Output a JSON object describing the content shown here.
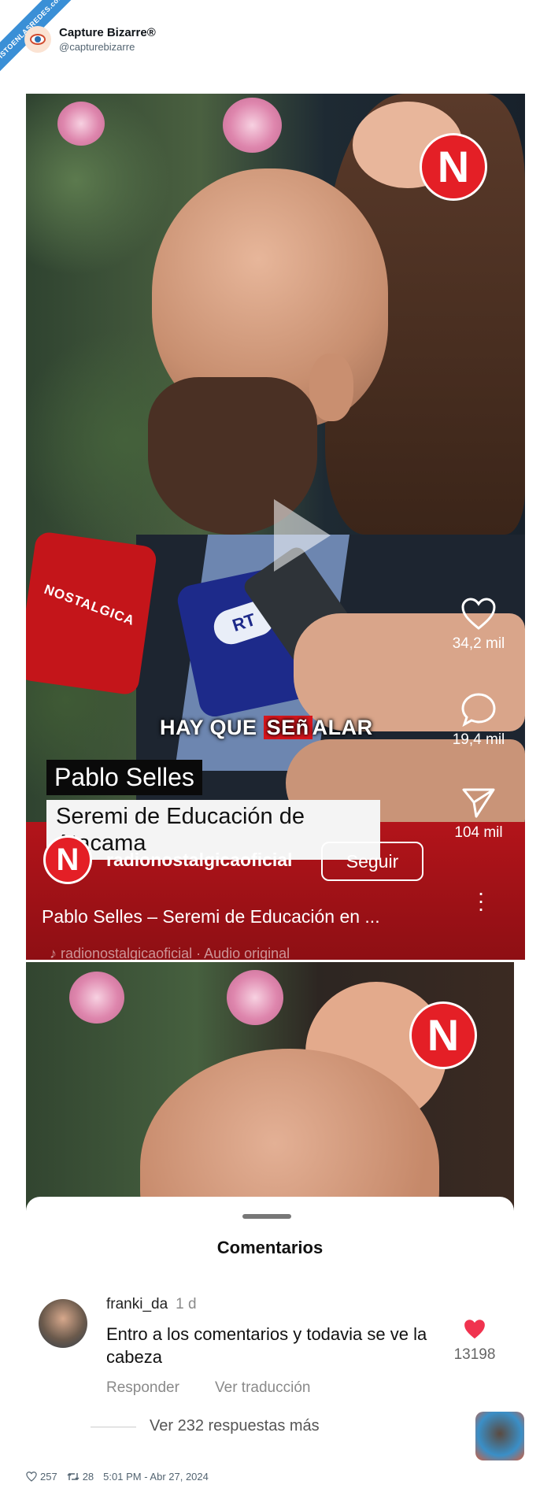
{
  "watermark": {
    "text": "VISTOENLASREDES.com"
  },
  "account": {
    "name": "Capture Bizarre®",
    "handle": "@capturebizarre"
  },
  "video1": {
    "brand_logo_letter": "N",
    "caption_pre": "HAY QUE ",
    "caption_highlight": "SEñ",
    "caption_post": "ALAR",
    "mic_red_text": "NOSTALGICA",
    "mic_blue_text": "RT",
    "lower_third_name": "Pablo Selles",
    "lower_third_role": "Seremi de Educación de Atacama",
    "stats": {
      "likes": "34,2 mil",
      "comments": "19,4 mil",
      "shares": "104 mil"
    },
    "channel_name": "radionostalgicaoficial",
    "follow_label": "Seguir",
    "description": "Pablo Selles – Seremi de Educación en ...",
    "audio": "♪ radionostalgicaoficial · Audio original"
  },
  "video2": {
    "brand_logo_letter": "N",
    "comments_panel": {
      "title": "Comentarios",
      "comment": {
        "user": "franki_da",
        "time": "1 d",
        "text": "Entro a los comentarios y todavia se ve la cabeza",
        "likes": "13198",
        "reply_label": "Responder",
        "translate_label": "Ver traducción"
      },
      "more_replies": "Ver 232 respuestas más"
    }
  },
  "footer": {
    "likes": "257",
    "retweets": "28",
    "timestamp": "5:01 PM - Abr 27, 2024"
  },
  "colors": {
    "brand_red": "#e41f26",
    "bar_red": "#b3141a",
    "ribbon_blue": "#3a8fd6",
    "heart_red": "#f0334f"
  }
}
